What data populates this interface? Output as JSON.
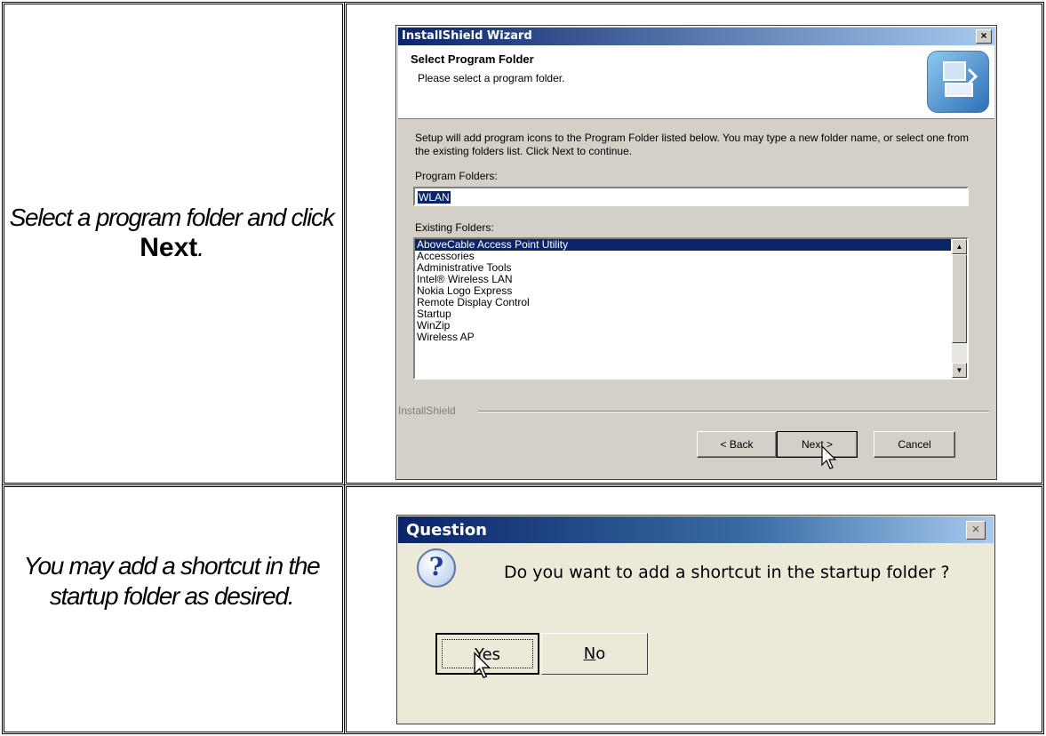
{
  "instructions": {
    "step1_prefix": "Select a program folder and click ",
    "step1_bold": "Next",
    "step1_suffix": ".",
    "step2": "You may add a shortcut in the startup folder as desired."
  },
  "installshield": {
    "window_title": "InstallShield Wizard",
    "close_glyph": "×",
    "header_title": "Select Program Folder",
    "header_subtitle": "Please select a program folder.",
    "body_text": "Setup will add program icons to the Program Folder listed below.  You may type a new folder name, or select one from the existing folders list.  Click Next to continue.",
    "program_folders_label": "Program Folders:",
    "program_folder_value": "WLAN",
    "existing_folders_label": "Existing Folders:",
    "existing_folders": [
      "AboveCable Access Point Utility",
      "Accessories",
      "Administrative Tools",
      "Intel® Wireless LAN",
      "Nokia Logo Express",
      "Remote Display Control",
      "Startup",
      "WinZip",
      "Wireless AP"
    ],
    "selected_folder_index": 0,
    "brand": "InstallShield",
    "back_label": "< Back",
    "next_label": "Next >",
    "cancel_label": "Cancel"
  },
  "question": {
    "window_title": "Question",
    "close_glyph": "×",
    "icon": "question-icon",
    "message": "Do you want to add a shortcut in the startup folder ?",
    "yes_label": "Yes",
    "no_label": "No"
  },
  "colors": {
    "selection": "#0a246a",
    "dialog_face": "#d4d0c8"
  }
}
